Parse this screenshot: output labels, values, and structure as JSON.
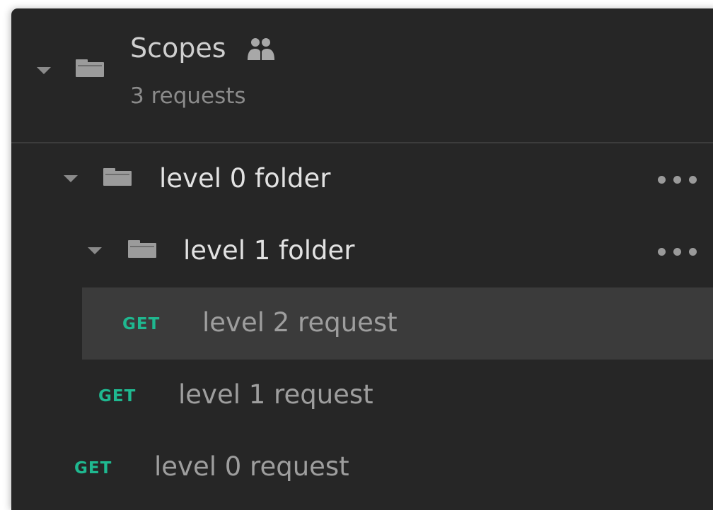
{
  "collection": {
    "name": "Scopes",
    "request_count": "3 requests",
    "shared_icon": "people-icon",
    "folder_icon": "folder-icon"
  },
  "tree": {
    "level0_folder": {
      "label": "level 0 folder",
      "expanded": true,
      "more_icon": "more-icon"
    },
    "level1_folder": {
      "label": "level 1 folder",
      "expanded": true,
      "more_icon": "more-icon"
    },
    "level2_request": {
      "method": "GET",
      "label": "level 2 request",
      "selected": true
    },
    "level1_request": {
      "method": "GET",
      "label": "level 1 request"
    },
    "level0_request": {
      "method": "GET",
      "label": "level 0 request"
    }
  },
  "colors": {
    "panel_bg": "#262626",
    "selected_bg": "#3b3b3b",
    "get_method": "#1fb890"
  }
}
